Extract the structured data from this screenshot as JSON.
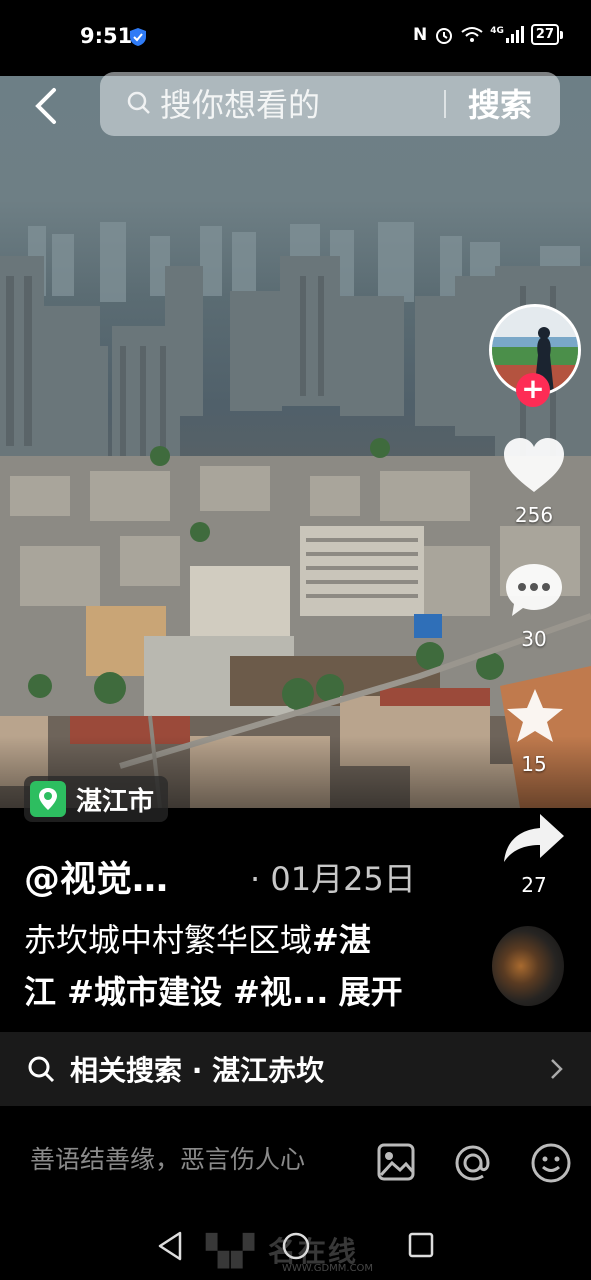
{
  "status": {
    "time": "9:51",
    "network": "4G",
    "battery": "27"
  },
  "search": {
    "placeholder": "搜你想看的",
    "button": "搜索"
  },
  "location": {
    "name": "湛江市"
  },
  "rail": {
    "likes": "256",
    "comments": "30",
    "favorites": "15",
    "shares": "27"
  },
  "post": {
    "author": "@视觉…",
    "date": "· 01月25日",
    "caption_line1_text": "赤坎城中村繁华区域",
    "caption_line1_tag": "#湛",
    "caption_line2_tags": "江 #城市建设 #视...",
    "expand": "展开"
  },
  "related": {
    "label": "相关搜索 · 湛江赤坎"
  },
  "comment": {
    "placeholder": "善语结善缘，恶言伤人心"
  },
  "watermark": {
    "text": "名在线",
    "url": "WWW.GDMM.COM"
  },
  "icons": [
    "back-icon",
    "search-icon",
    "location-pin-icon",
    "heart-icon",
    "comment-icon",
    "star-icon",
    "share-icon",
    "chevron-right-icon",
    "image-icon",
    "at-icon",
    "emoji-icon",
    "nav-back-icon",
    "nav-home-icon",
    "nav-recent-icon"
  ]
}
